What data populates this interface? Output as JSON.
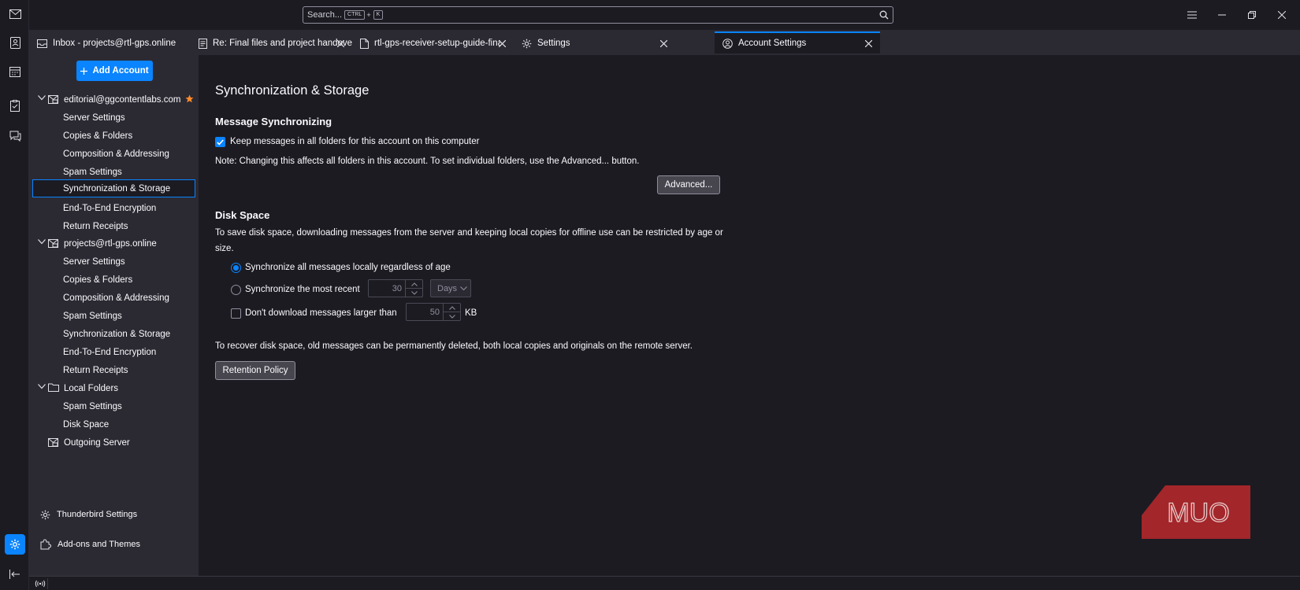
{
  "titlebar": {
    "search_placeholder": "Search...",
    "shortcut_key1": "CTRL",
    "shortcut_plus": "+",
    "shortcut_key2": "K"
  },
  "tabs": [
    {
      "label": "Inbox - projects@rtl-gps.online",
      "icon": "inbox-icon"
    },
    {
      "label": "Re: Final files and project handover",
      "icon": "message-icon"
    },
    {
      "label": "rtl-gps-receiver-setup-guide-final.p",
      "icon": "document-icon"
    },
    {
      "label": "Settings",
      "icon": "gear-icon"
    },
    {
      "label": "Account Settings",
      "icon": "account-settings-icon",
      "active": true
    }
  ],
  "sidebar": {
    "add_account_label": "Add Account",
    "accounts": [
      {
        "name": "editorial@ggcontentlabs.com",
        "items": [
          "Server Settings",
          "Copies & Folders",
          "Composition & Addressing",
          "Spam Settings",
          "Synchronization & Storage",
          "End-To-End Encryption",
          "Return Receipts"
        ]
      },
      {
        "name": "projects@rtl-gps.online",
        "items": [
          "Server Settings",
          "Copies & Folders",
          "Composition & Addressing",
          "Spam Settings",
          "Synchronization & Storage",
          "End-To-End Encryption",
          "Return Receipts"
        ]
      },
      {
        "name": "Local Folders",
        "items": [
          "Spam Settings",
          "Disk Space"
        ]
      }
    ],
    "outgoing_server": "Outgoing Server",
    "thunderbird_settings": "Thunderbird Settings",
    "addons_themes": "Add-ons and Themes"
  },
  "main": {
    "page_title": "Synchronization & Storage",
    "sync_heading": "Message Synchronizing",
    "keep_messages_label": "Keep messages in all folders for this account on this computer",
    "keep_messages_checked": true,
    "note": "Note: Changing this affects all folders in this account. To set individual folders, use the Advanced... button.",
    "advanced_button": "Advanced...",
    "disk_heading": "Disk Space",
    "disk_desc_line1": "To save disk space, downloading messages from the server and keeping local copies for offline use can be restricted by age or",
    "disk_desc_line2": "size.",
    "sync_all_label": "Synchronize all messages locally regardless of age",
    "sync_recent_label": "Synchronize the most recent",
    "sync_recent_value": "30",
    "sync_recent_unit": "Days",
    "dont_download_label": "Don't download messages larger than",
    "dont_download_value": "50",
    "dont_download_unit": "KB",
    "recover_text": "To recover disk space, old messages can be permanently deleted, both local copies and originals on the remote server.",
    "retention_button": "Retention Policy"
  },
  "logo_text": "MUO",
  "colors": {
    "accent": "#0a84ff",
    "star": "#ff8a2a",
    "logo": "#a3262a"
  }
}
